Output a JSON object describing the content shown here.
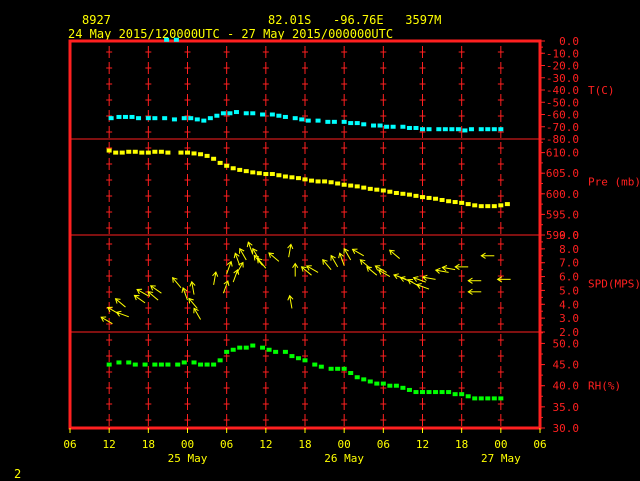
{
  "header": {
    "station_id": "8927",
    "location": "82.01S   -96.76E   3597M",
    "period": "24 May 2015/120000UTC - 27 May 2015/000000UTC"
  },
  "footer": {
    "page_number": "2"
  },
  "colors": {
    "frame": "#ff2020",
    "text": "#ffff00",
    "temperature": "#00ffff",
    "pressure": "#ffff00",
    "wind": "#ffff00",
    "humidity": "#00ff00"
  },
  "chart_data": {
    "type": "scatter",
    "x_axis": {
      "unit": "hours since 24 May 2015 00:00 UTC",
      "range": [
        6,
        78
      ],
      "tick_labels": [
        "06",
        "12",
        "18",
        "00",
        "06",
        "12",
        "18",
        "00",
        "06",
        "12",
        "18",
        "00",
        "06"
      ],
      "date_labels": [
        "25 May",
        "26 May",
        "27 May"
      ]
    },
    "panels": [
      {
        "id": "temperature",
        "label": "T(C)",
        "ylim": [
          -80,
          0
        ],
        "tick_labels": [
          "0.0",
          "-10.0",
          "-20.0",
          "-30.0",
          "-40.0",
          "-50.0",
          "-60.0",
          "-70.0",
          "-80.0"
        ],
        "series": [
          {
            "x": 12.3,
            "y": -63
          },
          {
            "x": 13.5,
            "y": -62
          },
          {
            "x": 14.5,
            "y": -62
          },
          {
            "x": 15.5,
            "y": -62
          },
          {
            "x": 16.5,
            "y": -63
          },
          {
            "x": 18,
            "y": -63
          },
          {
            "x": 19,
            "y": -63
          },
          {
            "x": 20.5,
            "y": -63
          },
          {
            "x": 22,
            "y": -64
          },
          {
            "x": 23.5,
            "y": -63
          },
          {
            "x": 24.5,
            "y": -63
          },
          {
            "x": 25.5,
            "y": -64
          },
          {
            "x": 26.5,
            "y": -65
          },
          {
            "x": 27.5,
            "y": -63
          },
          {
            "x": 28.5,
            "y": -61
          },
          {
            "x": 29.5,
            "y": -59
          },
          {
            "x": 30.5,
            "y": -59
          },
          {
            "x": 31.5,
            "y": -58
          },
          {
            "x": 33,
            "y": -59
          },
          {
            "x": 34,
            "y": -59
          },
          {
            "x": 35.5,
            "y": -60
          },
          {
            "x": 37,
            "y": -60
          },
          {
            "x": 38,
            "y": -61
          },
          {
            "x": 39,
            "y": -62
          },
          {
            "x": 40.5,
            "y": -63
          },
          {
            "x": 41.5,
            "y": -64
          },
          {
            "x": 42.5,
            "y": -65
          },
          {
            "x": 44,
            "y": -65
          },
          {
            "x": 45.5,
            "y": -66
          },
          {
            "x": 46.5,
            "y": -66
          },
          {
            "x": 48,
            "y": -66
          },
          {
            "x": 49,
            "y": -67
          },
          {
            "x": 50,
            "y": -67
          },
          {
            "x": 51,
            "y": -68
          },
          {
            "x": 52.5,
            "y": -69
          },
          {
            "x": 53.5,
            "y": -69
          },
          {
            "x": 54.5,
            "y": -70
          },
          {
            "x": 55.5,
            "y": -70
          },
          {
            "x": 57,
            "y": -70
          },
          {
            "x": 58,
            "y": -71
          },
          {
            "x": 59,
            "y": -71
          },
          {
            "x": 60,
            "y": -72
          },
          {
            "x": 61,
            "y": -72
          },
          {
            "x": 62.5,
            "y": -72
          },
          {
            "x": 63.5,
            "y": -72
          },
          {
            "x": 64.5,
            "y": -72
          },
          {
            "x": 65.5,
            "y": -72
          },
          {
            "x": 66.5,
            "y": -73
          },
          {
            "x": 67.5,
            "y": -72
          },
          {
            "x": 69,
            "y": -72
          },
          {
            "x": 70,
            "y": -72
          },
          {
            "x": 71,
            "y": -72
          },
          {
            "x": 72,
            "y": -72
          },
          {
            "x": 20.8,
            "y": 1
          },
          {
            "x": 22.3,
            "y": 1
          }
        ]
      },
      {
        "id": "pressure",
        "label": "Pre (mb)",
        "ylim": [
          590,
          613.3
        ],
        "tick_labels": [
          "590.0",
          "595.0",
          "600.0",
          "605.0",
          "610.0"
        ],
        "series": [
          {
            "x": 12,
            "y": 610.5
          },
          {
            "x": 13,
            "y": 610
          },
          {
            "x": 14,
            "y": 610
          },
          {
            "x": 15,
            "y": 610.2
          },
          {
            "x": 16,
            "y": 610.2
          },
          {
            "x": 17,
            "y": 610
          },
          {
            "x": 18,
            "y": 610
          },
          {
            "x": 19,
            "y": 610.2
          },
          {
            "x": 20,
            "y": 610.2
          },
          {
            "x": 21,
            "y": 610
          },
          {
            "x": 23,
            "y": 610
          },
          {
            "x": 24,
            "y": 610
          },
          {
            "x": 25,
            "y": 609.8
          },
          {
            "x": 26,
            "y": 609.6
          },
          {
            "x": 27,
            "y": 609.2
          },
          {
            "x": 28,
            "y": 608.5
          },
          {
            "x": 29,
            "y": 607.5
          },
          {
            "x": 30,
            "y": 606.8
          },
          {
            "x": 31,
            "y": 606.2
          },
          {
            "x": 32,
            "y": 605.8
          },
          {
            "x": 33,
            "y": 605.5
          },
          {
            "x": 34,
            "y": 605.2
          },
          {
            "x": 35,
            "y": 605
          },
          {
            "x": 36,
            "y": 604.8
          },
          {
            "x": 37,
            "y": 604.8
          },
          {
            "x": 38,
            "y": 604.5
          },
          {
            "x": 39,
            "y": 604.2
          },
          {
            "x": 40,
            "y": 604
          },
          {
            "x": 41,
            "y": 603.8
          },
          {
            "x": 42,
            "y": 603.5
          },
          {
            "x": 43,
            "y": 603.2
          },
          {
            "x": 44,
            "y": 603
          },
          {
            "x": 45,
            "y": 603
          },
          {
            "x": 46,
            "y": 602.8
          },
          {
            "x": 47,
            "y": 602.5
          },
          {
            "x": 48,
            "y": 602.2
          },
          {
            "x": 49,
            "y": 602
          },
          {
            "x": 50,
            "y": 601.8
          },
          {
            "x": 51,
            "y": 601.5
          },
          {
            "x": 52,
            "y": 601.2
          },
          {
            "x": 53,
            "y": 601
          },
          {
            "x": 54,
            "y": 600.8
          },
          {
            "x": 55,
            "y": 600.5
          },
          {
            "x": 56,
            "y": 600.2
          },
          {
            "x": 57,
            "y": 600
          },
          {
            "x": 58,
            "y": 599.8
          },
          {
            "x": 59,
            "y": 599.5
          },
          {
            "x": 60,
            "y": 599.2
          },
          {
            "x": 61,
            "y": 599
          },
          {
            "x": 62,
            "y": 598.8
          },
          {
            "x": 63,
            "y": 598.5
          },
          {
            "x": 64,
            "y": 598.2
          },
          {
            "x": 65,
            "y": 598
          },
          {
            "x": 66,
            "y": 597.8
          },
          {
            "x": 67,
            "y": 597.5
          },
          {
            "x": 68,
            "y": 597.2
          },
          {
            "x": 69,
            "y": 597
          },
          {
            "x": 70,
            "y": 597
          },
          {
            "x": 71,
            "y": 597
          },
          {
            "x": 72,
            "y": 597.2
          },
          {
            "x": 73,
            "y": 597.5
          }
        ]
      },
      {
        "id": "wind_speed",
        "label": "SPD(MPS)",
        "ylim": [
          2,
          9
        ],
        "tick_labels": [
          "2.0",
          "3.0",
          "4.0",
          "5.0",
          "6.0",
          "7.0",
          "8.0",
          "9.0"
        ],
        "series": [
          {
            "x": 12.5,
            "y": 2.6,
            "dir": 300
          },
          {
            "x": 13.5,
            "y": 3.3,
            "dir": 300
          },
          {
            "x": 14.5,
            "y": 3.8,
            "dir": 310
          },
          {
            "x": 15,
            "y": 3.1,
            "dir": 290
          },
          {
            "x": 17.5,
            "y": 4.1,
            "dir": 305
          },
          {
            "x": 18,
            "y": 4.6,
            "dir": 300
          },
          {
            "x": 19.5,
            "y": 4.3,
            "dir": 310
          },
          {
            "x": 20,
            "y": 4.8,
            "dir": 305
          },
          {
            "x": 23,
            "y": 5.2,
            "dir": 320
          },
          {
            "x": 24,
            "y": 4.3,
            "dir": 340
          },
          {
            "x": 25,
            "y": 4.7,
            "dir": 350
          },
          {
            "x": 25.5,
            "y": 3.7,
            "dir": 320
          },
          {
            "x": 26,
            "y": 2.9,
            "dir": 330
          },
          {
            "x": 28,
            "y": 5.4,
            "dir": 10
          },
          {
            "x": 29.5,
            "y": 4.8,
            "dir": 20
          },
          {
            "x": 30,
            "y": 6.2,
            "dir": 20
          },
          {
            "x": 31,
            "y": 5.6,
            "dir": 20
          },
          {
            "x": 31.5,
            "y": 6.2,
            "dir": 30
          },
          {
            "x": 32,
            "y": 6.8,
            "dir": 340
          },
          {
            "x": 33,
            "y": 7.2,
            "dir": 330
          },
          {
            "x": 34,
            "y": 7.6,
            "dir": 340
          },
          {
            "x": 35,
            "y": 7.2,
            "dir": 330
          },
          {
            "x": 35.5,
            "y": 6.8,
            "dir": 320
          },
          {
            "x": 36,
            "y": 6.6,
            "dir": 320
          },
          {
            "x": 38,
            "y": 7.1,
            "dir": 310
          },
          {
            "x": 39.5,
            "y": 7.4,
            "dir": 10
          },
          {
            "x": 40.5,
            "y": 6.0,
            "dir": 0
          },
          {
            "x": 40,
            "y": 3.7,
            "dir": 350
          },
          {
            "x": 43,
            "y": 6.1,
            "dir": 310
          },
          {
            "x": 44,
            "y": 6.3,
            "dir": 300
          },
          {
            "x": 46,
            "y": 6.5,
            "dir": 320
          },
          {
            "x": 47,
            "y": 6.7,
            "dir": 330
          },
          {
            "x": 48,
            "y": 6.8,
            "dir": 340
          },
          {
            "x": 49,
            "y": 7.2,
            "dir": 330
          },
          {
            "x": 51,
            "y": 7.5,
            "dir": 300
          },
          {
            "x": 52,
            "y": 6.6,
            "dir": 310
          },
          {
            "x": 53,
            "y": 6.1,
            "dir": 310
          },
          {
            "x": 54.5,
            "y": 6.3,
            "dir": 300
          },
          {
            "x": 55,
            "y": 6.0,
            "dir": 300
          },
          {
            "x": 56.5,
            "y": 7.3,
            "dir": 310
          },
          {
            "x": 57.5,
            "y": 5.8,
            "dir": 290
          },
          {
            "x": 58.5,
            "y": 5.6,
            "dir": 290
          },
          {
            "x": 59.5,
            "y": 5.3,
            "dir": 300
          },
          {
            "x": 60.5,
            "y": 5.6,
            "dir": 290
          },
          {
            "x": 61,
            "y": 5.1,
            "dir": 290
          },
          {
            "x": 62,
            "y": 5.8,
            "dir": 280
          },
          {
            "x": 64,
            "y": 6.3,
            "dir": 280
          },
          {
            "x": 65,
            "y": 6.5,
            "dir": 280
          },
          {
            "x": 67,
            "y": 6.7,
            "dir": 270
          },
          {
            "x": 69,
            "y": 5.7,
            "dir": 270
          },
          {
            "x": 69,
            "y": 4.9,
            "dir": 270
          },
          {
            "x": 71,
            "y": 7.5,
            "dir": 270
          },
          {
            "x": 73.5,
            "y": 5.8,
            "dir": 270
          }
        ]
      },
      {
        "id": "humidity",
        "label": "RH(%)",
        "ylim": [
          30,
          52.7
        ],
        "tick_labels": [
          "30.0",
          "35.0",
          "40.0",
          "45.0",
          "50.0"
        ],
        "series": [
          {
            "x": 12,
            "y": 45
          },
          {
            "x": 13.5,
            "y": 45.5
          },
          {
            "x": 15,
            "y": 45.5
          },
          {
            "x": 16,
            "y": 45
          },
          {
            "x": 17.5,
            "y": 45
          },
          {
            "x": 19,
            "y": 45
          },
          {
            "x": 20,
            "y": 45
          },
          {
            "x": 21,
            "y": 45
          },
          {
            "x": 22.5,
            "y": 45
          },
          {
            "x": 23.5,
            "y": 45.5
          },
          {
            "x": 25,
            "y": 45.5
          },
          {
            "x": 26,
            "y": 45
          },
          {
            "x": 27,
            "y": 45
          },
          {
            "x": 28,
            "y": 45
          },
          {
            "x": 29,
            "y": 46
          },
          {
            "x": 30,
            "y": 48
          },
          {
            "x": 31,
            "y": 48.5
          },
          {
            "x": 32,
            "y": 49
          },
          {
            "x": 33,
            "y": 49
          },
          {
            "x": 34,
            "y": 49.5
          },
          {
            "x": 35.5,
            "y": 49
          },
          {
            "x": 36.5,
            "y": 48.5
          },
          {
            "x": 37.5,
            "y": 48
          },
          {
            "x": 39,
            "y": 48
          },
          {
            "x": 40,
            "y": 47
          },
          {
            "x": 41,
            "y": 46.5
          },
          {
            "x": 42,
            "y": 46
          },
          {
            "x": 43.5,
            "y": 45
          },
          {
            "x": 44.5,
            "y": 44.5
          },
          {
            "x": 46,
            "y": 44
          },
          {
            "x": 47,
            "y": 44
          },
          {
            "x": 48,
            "y": 44
          },
          {
            "x": 49,
            "y": 43
          },
          {
            "x": 50,
            "y": 42
          },
          {
            "x": 51,
            "y": 41.5
          },
          {
            "x": 52,
            "y": 41
          },
          {
            "x": 53,
            "y": 40.5
          },
          {
            "x": 54,
            "y": 40.5
          },
          {
            "x": 55,
            "y": 40
          },
          {
            "x": 56,
            "y": 40
          },
          {
            "x": 57,
            "y": 39.5
          },
          {
            "x": 58,
            "y": 39
          },
          {
            "x": 59,
            "y": 38.5
          },
          {
            "x": 60,
            "y": 38.5
          },
          {
            "x": 61,
            "y": 38.5
          },
          {
            "x": 62,
            "y": 38.5
          },
          {
            "x": 63,
            "y": 38.5
          },
          {
            "x": 64,
            "y": 38.5
          },
          {
            "x": 65,
            "y": 38
          },
          {
            "x": 66,
            "y": 38
          },
          {
            "x": 67,
            "y": 37.5
          },
          {
            "x": 68,
            "y": 37
          },
          {
            "x": 69,
            "y": 37
          },
          {
            "x": 70,
            "y": 37
          },
          {
            "x": 71,
            "y": 37
          },
          {
            "x": 72,
            "y": 37
          }
        ]
      }
    ]
  }
}
